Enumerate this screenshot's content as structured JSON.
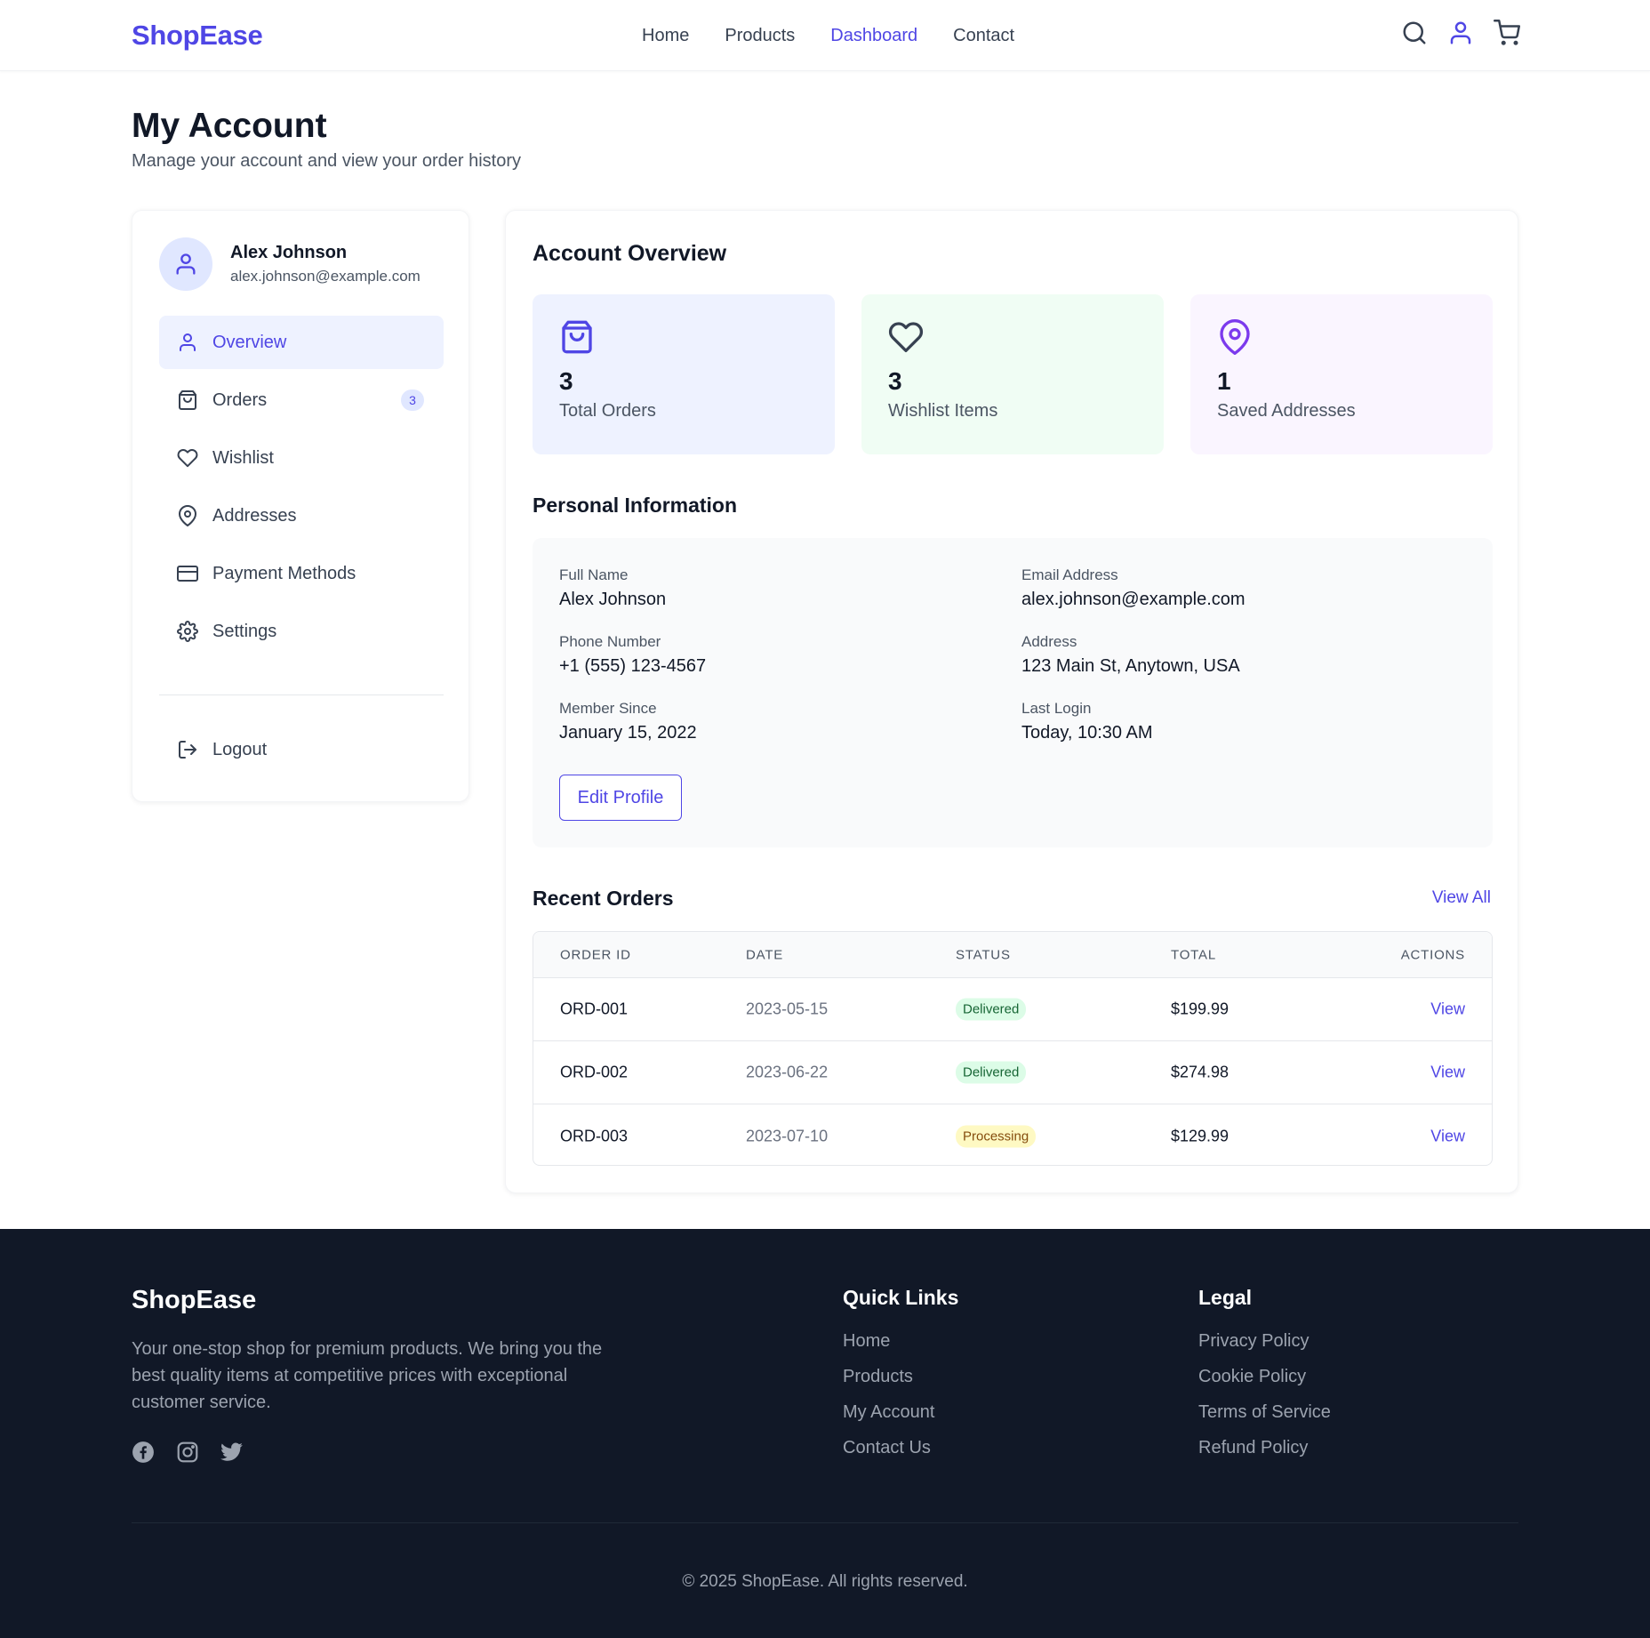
{
  "header": {
    "brand": "ShopEase",
    "nav": [
      "Home",
      "Products",
      "Dashboard",
      "Contact"
    ],
    "active_nav": "Dashboard",
    "icons": [
      "search-icon",
      "user-icon",
      "cart-icon"
    ]
  },
  "page": {
    "title": "My Account",
    "subtitle": "Manage your account and view your order history"
  },
  "sidebar": {
    "user_name": "Alex Johnson",
    "user_email": "alex.johnson@example.com",
    "items": [
      {
        "label": "Overview",
        "icon": "user-icon",
        "active": true
      },
      {
        "label": "Orders",
        "icon": "shopping-bag-icon",
        "badge": "3"
      },
      {
        "label": "Wishlist",
        "icon": "heart-icon"
      },
      {
        "label": "Addresses",
        "icon": "map-pin-icon"
      },
      {
        "label": "Payment Methods",
        "icon": "credit-card-icon"
      },
      {
        "label": "Settings",
        "icon": "gear-icon"
      }
    ],
    "logout_label": "Logout"
  },
  "overview": {
    "title": "Account Overview",
    "stats": [
      {
        "value": "3",
        "label": "Total Orders",
        "icon": "shopping-bag-icon",
        "bg": "#eef2ff",
        "color": "#4f46e5"
      },
      {
        "value": "3",
        "label": "Wishlist Items",
        "icon": "heart-icon",
        "bg": "#f0fdf4",
        "color": "#374151"
      },
      {
        "value": "1",
        "label": "Saved Addresses",
        "icon": "map-pin-icon",
        "bg": "#faf5ff",
        "color": "#7c3aed"
      }
    ]
  },
  "personal": {
    "title": "Personal Information",
    "full_name_label": "Full Name",
    "full_name": "Alex Johnson",
    "email_label": "Email Address",
    "email": "alex.johnson@example.com",
    "phone_label": "Phone Number",
    "phone": "+1 (555) 123-4567",
    "address_label": "Address",
    "address": "123 Main St, Anytown, USA",
    "member_label": "Member Since",
    "member_since": "January 15, 2022",
    "login_label": "Last Login",
    "last_login": "Today, 10:30 AM",
    "edit_label": "Edit Profile"
  },
  "orders": {
    "title": "Recent Orders",
    "view_all": "View All",
    "columns": [
      "ORDER ID",
      "DATE",
      "STATUS",
      "TOTAL",
      "ACTIONS"
    ],
    "rows": [
      {
        "id": "ORD-001",
        "date": "2023-05-15",
        "status": "Delivered",
        "total": "$199.99",
        "action": "View"
      },
      {
        "id": "ORD-002",
        "date": "2023-06-22",
        "status": "Delivered",
        "total": "$274.98",
        "action": "View"
      },
      {
        "id": "ORD-003",
        "date": "2023-07-10",
        "status": "Processing",
        "total": "$129.99",
        "action": "View"
      }
    ]
  },
  "footer": {
    "brand": "ShopEase",
    "description": "Your one-stop shop for premium products. We bring you the best quality items at competitive prices with exceptional customer service.",
    "social": [
      "facebook-icon",
      "instagram-icon",
      "twitter-icon"
    ],
    "quick_links_title": "Quick Links",
    "quick_links": [
      "Home",
      "Products",
      "My Account",
      "Contact Us"
    ],
    "legal_title": "Legal",
    "legal": [
      "Privacy Policy",
      "Cookie Policy",
      "Terms of Service",
      "Refund Policy"
    ],
    "copyright": "© 2025 ShopEase. All rights reserved."
  },
  "colors": {
    "accent": "#4f46e5",
    "footer_bg": "#111827",
    "delivered_bg": "#dcfce7",
    "processing_bg": "#fef9c3"
  }
}
